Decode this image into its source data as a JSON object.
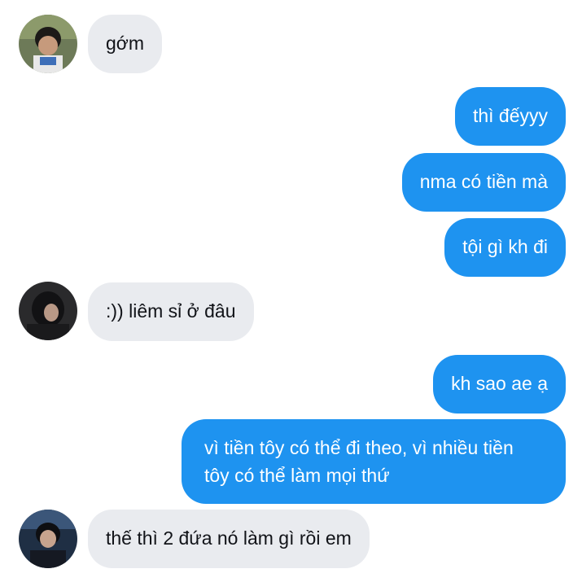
{
  "messages": [
    {
      "sender": "other",
      "text": "gớm"
    },
    {
      "sender": "me",
      "text": "thì đếyyy"
    },
    {
      "sender": "me",
      "text": "nma có tiền mà"
    },
    {
      "sender": "me",
      "text": "tội gì kh đi"
    },
    {
      "sender": "other",
      "text": ":)) liêm sỉ ở đâu"
    },
    {
      "sender": "me",
      "text": "kh sao ae ạ"
    },
    {
      "sender": "me",
      "text": "vì tiền tôy có thể đi theo, vì nhiều tiền tôy có thể làm mọi thứ"
    },
    {
      "sender": "other",
      "text": "thế thì 2 đứa nó làm gì rồi em"
    }
  ],
  "colors": {
    "outgoing_bubble": "#1e93f0",
    "incoming_bubble": "#e9ebef",
    "background": "#ffffff"
  }
}
